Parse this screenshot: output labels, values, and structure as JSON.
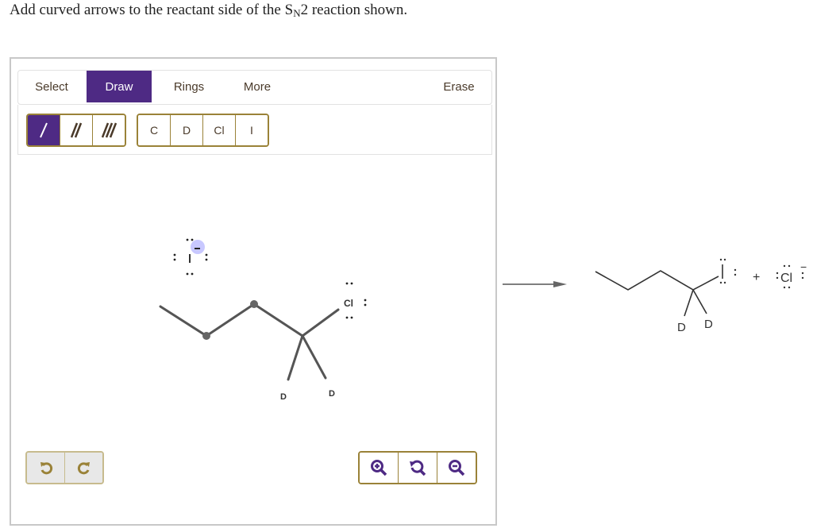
{
  "prompt": {
    "text_before": "Add curved arrows to the reactant side of the S",
    "subscript": "N",
    "text_after": "2 reaction shown."
  },
  "toolbar": {
    "tabs": [
      {
        "label": "Select",
        "active": false
      },
      {
        "label": "Draw",
        "active": true
      },
      {
        "label": "Rings",
        "active": false
      },
      {
        "label": "More",
        "active": false
      }
    ],
    "erase_label": "Erase"
  },
  "bond_buttons": [
    {
      "name": "single-bond",
      "glyph": "/",
      "active": true
    },
    {
      "name": "double-bond",
      "glyph": "//",
      "active": false
    },
    {
      "name": "triple-bond",
      "glyph": "///",
      "active": false
    }
  ],
  "atom_buttons": [
    {
      "label": "C"
    },
    {
      "label": "D"
    },
    {
      "label": "Cl"
    },
    {
      "label": "I"
    }
  ],
  "reactants": {
    "nucleophile": {
      "symbol": "I",
      "charge": "-",
      "lone_pairs": 4
    },
    "substrate": {
      "leaving_group": "Cl",
      "leaving_group_lone_pairs": 3,
      "substituents": [
        "D",
        "D"
      ]
    }
  },
  "products": {
    "substitution_product": {
      "halogen": "I",
      "lone_pairs": 3,
      "substituents": [
        "D",
        "D"
      ]
    },
    "plus": "+",
    "leaving_ion": {
      "symbol": "Cl",
      "charge": "−",
      "lone_pairs": 4
    }
  },
  "history_buttons": [
    {
      "name": "undo",
      "glyph": "↺"
    },
    {
      "name": "redo",
      "glyph": "↻"
    }
  ],
  "zoom_buttons": [
    {
      "name": "zoom-in"
    },
    {
      "name": "reset-zoom"
    },
    {
      "name": "zoom-out"
    }
  ],
  "colors": {
    "accent": "#4e2a84",
    "button_border": "#9a8238",
    "bond": "#555555",
    "highlight": "#c8c8ff"
  }
}
